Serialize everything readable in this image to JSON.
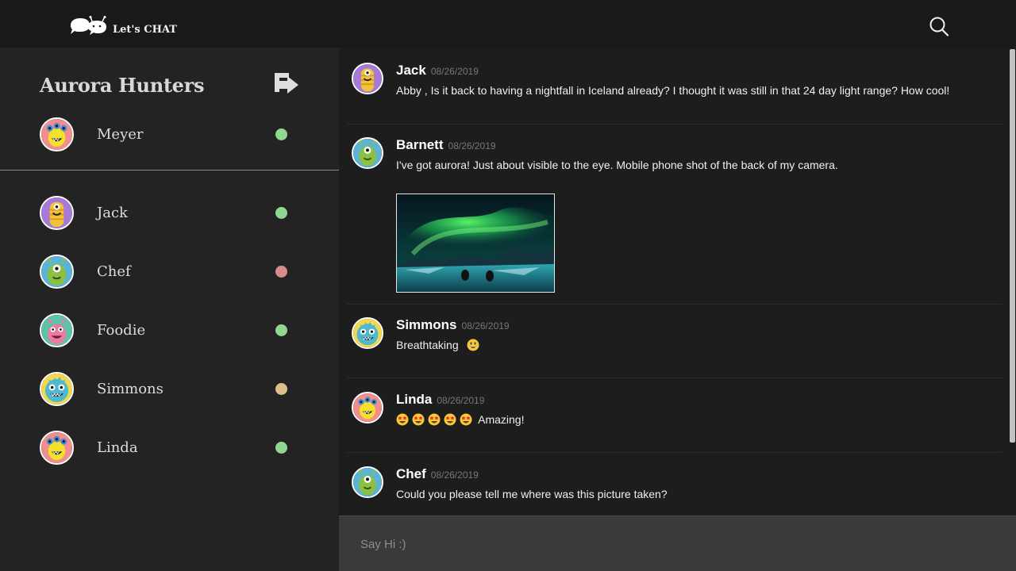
{
  "app": {
    "logo_text": "Let's CHAT"
  },
  "colors": {
    "online": "#90d890",
    "busy": "#d88c8c",
    "away": "#dcc08c"
  },
  "sidebar": {
    "group_name": "Aurora Hunters",
    "owner": {
      "name": "Meyer",
      "status": "online",
      "avatar": "pink-monster-avatar"
    },
    "members": [
      {
        "name": "Jack",
        "status": "online",
        "avatar": "purple-monster-avatar"
      },
      {
        "name": "Chef",
        "status": "busy",
        "avatar": "green-monster-avatar"
      },
      {
        "name": "Foodie",
        "status": "online",
        "avatar": "pink-horned-monster-avatar"
      },
      {
        "name": "Simmons",
        "status": "away",
        "avatar": "blue-monster-avatar"
      },
      {
        "name": "Linda",
        "status": "online",
        "avatar": "pink-monster-avatar"
      }
    ]
  },
  "messages": [
    {
      "author": "Jack",
      "date": "08/26/2019",
      "text": "Abby , Is it back to having a nightfall in Iceland already? I thought it was still in that 24 day light range? How cool!"
    },
    {
      "author": "Barnett",
      "date": "08/26/2019",
      "text": "I've got aurora! Just about visible to the eye. Mobile phone shot of the back of my camera.",
      "attachment": "aurora-photo"
    },
    {
      "author": "Simmons",
      "date": "08/26/2019",
      "text": "Breathtaking",
      "emoji": [
        "grinning-emoji"
      ]
    },
    {
      "author": "Linda",
      "date": "08/26/2019",
      "text": "Amazing!",
      "emoji": [
        "star-struck-emoji",
        "star-struck-emoji",
        "star-struck-emoji",
        "star-struck-emoji",
        "star-struck-emoji"
      ]
    },
    {
      "author": "Chef",
      "date": "08/26/2019",
      "text": "Could you please tell me where was this picture taken?"
    }
  ],
  "composer": {
    "placeholder": "Say Hi :)"
  }
}
